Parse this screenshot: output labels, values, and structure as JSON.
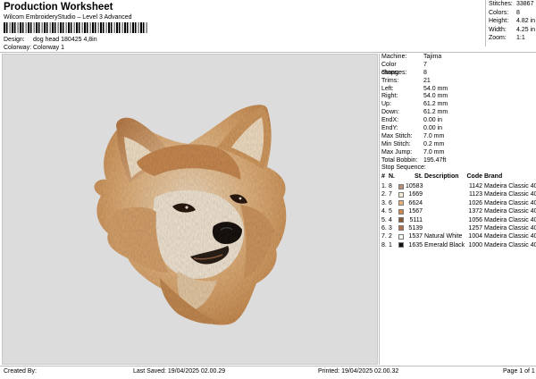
{
  "header": {
    "title": "Production Worksheet",
    "subtitle": "Wilcom EmbroideryStudio – Level 3 Advanced",
    "design_label": "Design:",
    "design_value": "dog head 180425 4,8in",
    "colorway_label": "Colorway:",
    "colorway_value": "Colorway 1"
  },
  "stats": [
    {
      "label": "Stitches:",
      "value": "33867"
    },
    {
      "label": "Colors:",
      "value": "8"
    },
    {
      "label": "Height:",
      "value": "4.82 in"
    },
    {
      "label": "Width:",
      "value": "4.25 in"
    },
    {
      "label": "Zoom:",
      "value": "1:1"
    }
  ],
  "machine_info": [
    {
      "label": "Machine:",
      "value": "Tajima"
    },
    {
      "label": "Color changes:",
      "value": "7"
    },
    {
      "label": "Stops:",
      "value": "8"
    },
    {
      "label": "Trims:",
      "value": "21"
    },
    {
      "label": "Left:",
      "value": "54.0 mm"
    },
    {
      "label": "Right:",
      "value": "54.0 mm"
    },
    {
      "label": "Up:",
      "value": "61.2 mm"
    },
    {
      "label": "Down:",
      "value": "61.2 mm"
    },
    {
      "label": "EndX:",
      "value": "0.00 in"
    },
    {
      "label": "EndY:",
      "value": "0.00 in"
    },
    {
      "label": "Max Stitch:",
      "value": "7.0 mm"
    },
    {
      "label": "Min Stitch:",
      "value": "0.2 mm"
    },
    {
      "label": "Max Jump:",
      "value": "7.0 mm"
    },
    {
      "label": "Total Bobbin:",
      "value": "195.47ft"
    }
  ],
  "stop_sequence": {
    "title": "Stop Sequence:",
    "headers": {
      "num": "#",
      "n": "N.",
      "st": "St.",
      "description": "Description",
      "code": "Code",
      "brand": "Brand"
    },
    "rows": [
      {
        "num": "1.",
        "idx": "8",
        "color": "#b89078",
        "st": "10583",
        "description": "",
        "code": "1142",
        "brand": "Madeira Classic 40"
      },
      {
        "num": "2.",
        "idx": "7",
        "color": "#f4ecd8",
        "st": "1669",
        "description": "",
        "code": "1123",
        "brand": "Madeira Classic 40"
      },
      {
        "num": "3.",
        "idx": "6",
        "color": "#e8b07a",
        "st": "6624",
        "description": "",
        "code": "1026",
        "brand": "Madeira Classic 40"
      },
      {
        "num": "4.",
        "idx": "5",
        "color": "#c98a4c",
        "st": "1567",
        "description": "",
        "code": "1372",
        "brand": "Madeira Classic 40"
      },
      {
        "num": "5.",
        "idx": "4",
        "color": "#8a5a35",
        "st": "5111",
        "description": "",
        "code": "1056",
        "brand": "Madeira Classic 40"
      },
      {
        "num": "6.",
        "idx": "3",
        "color": "#b3714a",
        "st": "5139",
        "description": "",
        "code": "1257",
        "brand": "Madeira Classic 40"
      },
      {
        "num": "7.",
        "idx": "2",
        "color": "#f7f5ee",
        "st": "1537",
        "description": "Natural White",
        "code": "1004",
        "brand": "Madeira Classic 40"
      },
      {
        "num": "8.",
        "idx": "1",
        "color": "#111111",
        "st": "1635",
        "description": "Emerald Black",
        "code": "1000",
        "brand": "Madeira Classic 40"
      }
    ]
  },
  "footer": {
    "created": "Created By:",
    "saved": "Last Saved: 19/04/2025 02.00.29",
    "printed": "Printed: 19/04/2025 02.00.32",
    "page": "Page 1 of 1"
  }
}
